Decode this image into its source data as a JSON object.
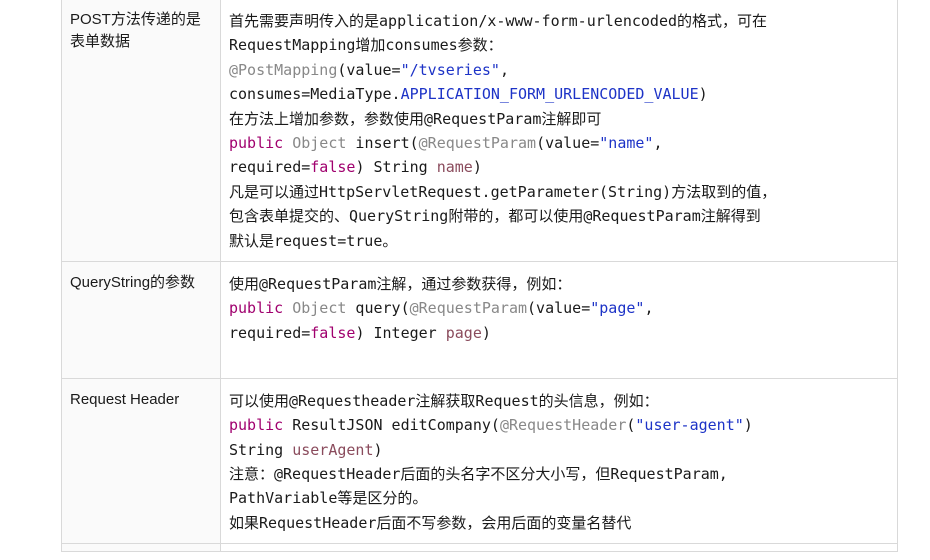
{
  "rows": [
    {
      "key": "POST方法传递的是表单数据",
      "lines": [
        [
          [
            "t",
            "首先需要声明传入的是application/x-www-form-urlencoded的格式，可在"
          ]
        ],
        [
          [
            "t",
            "RequestMapping增加consumes参数："
          ]
        ],
        [
          [
            "an",
            "@PostMapping"
          ],
          [
            "t",
            "(value="
          ],
          [
            "st",
            "\"/tvseries\""
          ],
          [
            "t",
            ","
          ]
        ],
        [
          [
            "t",
            "consumes=MediaType."
          ],
          [
            "cs",
            "APPLICATION_FORM_URLENCODED_VALUE"
          ],
          [
            "t",
            ")"
          ]
        ],
        [
          [
            "t",
            "在方法上增加参数，参数使用@RequestParam注解即可"
          ]
        ],
        [
          [
            "kw",
            "public"
          ],
          [
            "t",
            " "
          ],
          [
            "ty",
            "Object"
          ],
          [
            "t",
            " insert("
          ],
          [
            "an",
            "@RequestParam"
          ],
          [
            "t",
            "(value="
          ],
          [
            "st",
            "\"name\""
          ],
          [
            "t",
            ","
          ]
        ],
        [
          [
            "t",
            "required="
          ],
          [
            "kw",
            "false"
          ],
          [
            "t",
            ") String "
          ],
          [
            "va",
            "name"
          ],
          [
            "t",
            ")"
          ]
        ],
        [
          [
            "t",
            "凡是可以通过HttpServletRequest.getParameter(String)方法取到的值，"
          ]
        ],
        [
          [
            "t",
            "包含表单提交的、QueryString附带的，都可以使用@RequestParam注解得到"
          ]
        ],
        [
          [
            "t",
            "默认是request=true。"
          ]
        ]
      ]
    },
    {
      "key": "QueryString的参数",
      "lines": [
        [
          [
            "t",
            "使用@RequestParam注解，通过参数获得，例如："
          ]
        ],
        [
          [
            "kw",
            "public"
          ],
          [
            "t",
            " "
          ],
          [
            "ty",
            "Object"
          ],
          [
            "t",
            " query("
          ],
          [
            "an",
            "@RequestParam"
          ],
          [
            "t",
            "(value="
          ],
          [
            "st",
            "\"page\""
          ],
          [
            "t",
            ","
          ]
        ],
        [
          [
            "t",
            "required="
          ],
          [
            "kw",
            "false"
          ],
          [
            "t",
            ") Integer "
          ],
          [
            "va",
            "page"
          ],
          [
            "t",
            ")"
          ]
        ],
        [
          [
            "t",
            ""
          ]
        ]
      ]
    },
    {
      "key": "Request Header",
      "lines": [
        [
          [
            "t",
            "可以使用@Requestheader注解获取Request的头信息，例如："
          ]
        ],
        [
          [
            "kw",
            "public"
          ],
          [
            "t",
            " ResultJSON editCompany("
          ],
          [
            "an",
            "@RequestHeader"
          ],
          [
            "t",
            "("
          ],
          [
            "st",
            "\"user-agent\""
          ],
          [
            "t",
            ")"
          ]
        ],
        [
          [
            "t",
            "String "
          ],
          [
            "va",
            "userAgent"
          ],
          [
            "t",
            ")"
          ]
        ],
        [
          [
            "t",
            "注意：@RequestHeader后面的头名字不区分大小写，但RequestParam,"
          ]
        ],
        [
          [
            "t",
            "PathVariable等是区分的。"
          ]
        ],
        [
          [
            "t",
            "如果RequestHeader后面不写参数，会用后面的变量名替代"
          ]
        ]
      ]
    }
  ]
}
